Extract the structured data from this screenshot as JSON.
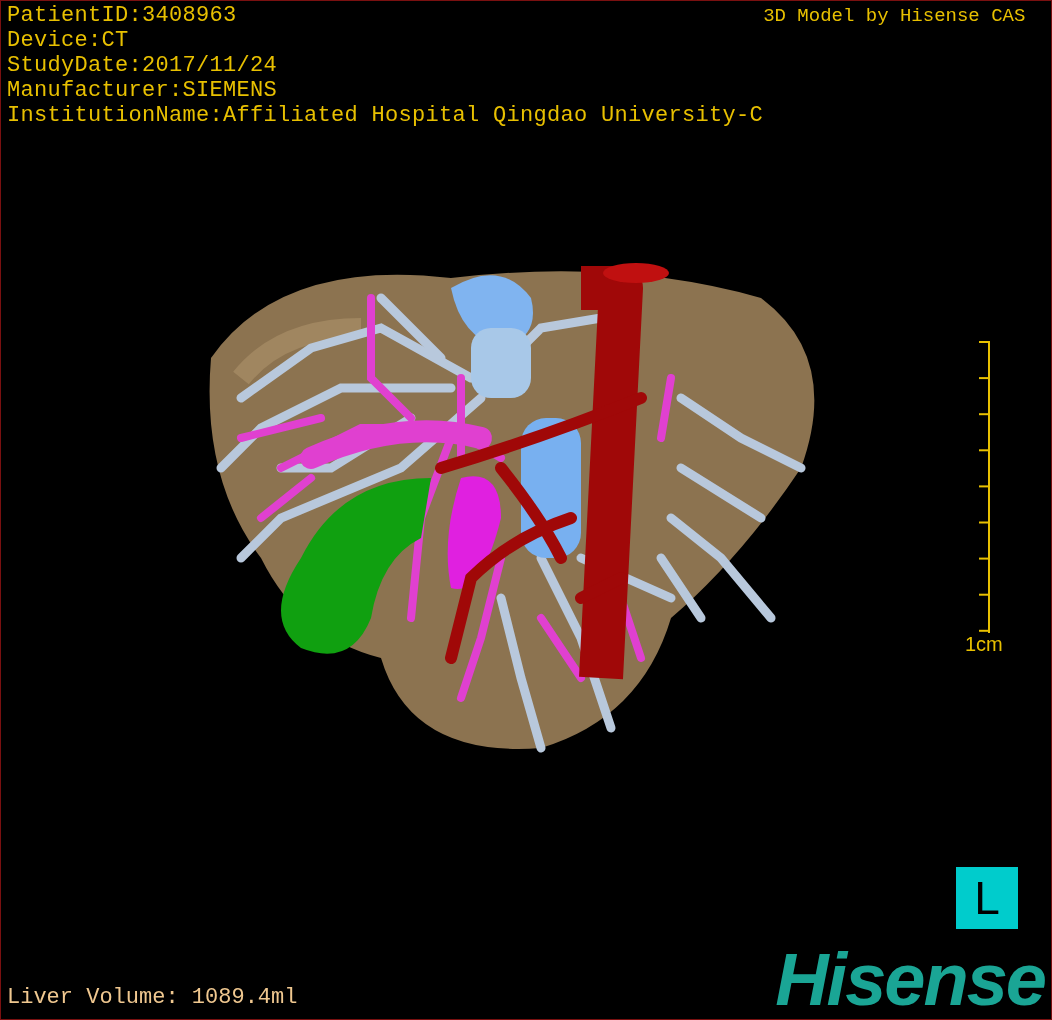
{
  "header": {
    "info": [
      "PatientID:3408963",
      "Device:CT",
      "StudyDate:2017/11/24",
      "Manufacturer:SIEMENS",
      "InstitutionName:Affiliated Hospital Qingdao University-C"
    ],
    "title": "3D Model by Hisense CAS"
  },
  "scale_bar": {
    "label": "1cm"
  },
  "footer": {
    "liver_volume": "Liver Volume: 1089.4ml",
    "orientation": "L",
    "logo": "Hisense"
  }
}
